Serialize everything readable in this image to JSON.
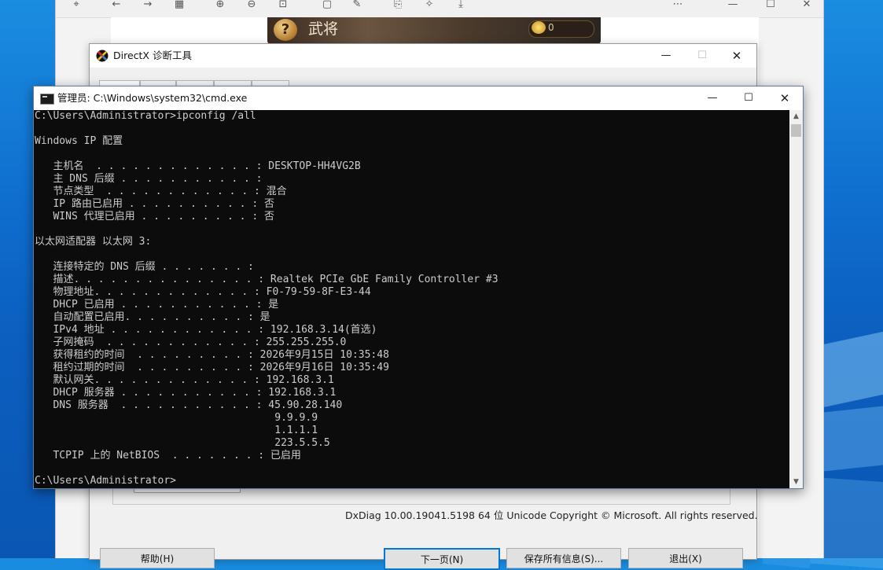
{
  "desktop": {},
  "viewer": {
    "game_banner": {
      "icon_label": "?",
      "title": "武将",
      "coin_value": "0"
    }
  },
  "dxdiag": {
    "title": "DirectX 诊断工具",
    "footer": "DxDiag 10.00.19041.5198 64 位 Unicode  Copyright © Microsoft. All rights reserved.",
    "buttons": {
      "help": "帮助(H)",
      "next_page": "下一页(N)",
      "save_all": "保存所有信息(S)...",
      "exit": "退出(X)"
    }
  },
  "cmd": {
    "title": "管理员: C:\\Windows\\system32\\cmd.exe",
    "lines": [
      "C:\\Users\\Administrator>ipconfig /all",
      "",
      "Windows IP 配置",
      "",
      "   主机名  . . . . . . . . . . . . . : DESKTOP-HH4VG2B",
      "   主 DNS 后缀 . . . . . . . . . . . :",
      "   节点类型  . . . . . . . . . . . . : 混合",
      "   IP 路由已启用 . . . . . . . . . . : 否",
      "   WINS 代理已启用 . . . . . . . . . : 否",
      "",
      "以太网适配器 以太网 3:",
      "",
      "   连接特定的 DNS 后缀 . . . . . . . :",
      "   描述. . . . . . . . . . . . . . . : Realtek PCIe GbE Family Controller #3",
      "   物理地址. . . . . . . . . . . . . : F0-79-59-8F-E3-44",
      "   DHCP 已启用 . . . . . . . . . . . : 是",
      "   自动配置已启用. . . . . . . . . . : 是",
      "   IPv4 地址 . . . . . . . . . . . . : 192.168.3.14(首选)",
      "   子网掩码  . . . . . . . . . . . . : 255.255.255.0",
      "   获得租约的时间  . . . . . . . . . : 2026年9月15日 10:35:48",
      "   租约过期的时间  . . . . . . . . . : 2026年9月16日 10:35:49",
      "   默认网关. . . . . . . . . . . . . : 192.168.3.1",
      "   DHCP 服务器 . . . . . . . . . . . : 192.168.3.1",
      "   DNS 服务器  . . . . . . . . . . . : 45.90.28.140",
      "                                       9.9.9.9",
      "                                       1.1.1.1",
      "                                       223.5.5.5",
      "   TCPIP 上的 NetBIOS  . . . . . . . : 已启用",
      "",
      "C:\\Users\\Administrator>"
    ]
  },
  "icons": {
    "minimize": "—",
    "maximize": "☐",
    "close": "✕",
    "scroll_up": "▲",
    "scroll_down": "▼"
  }
}
